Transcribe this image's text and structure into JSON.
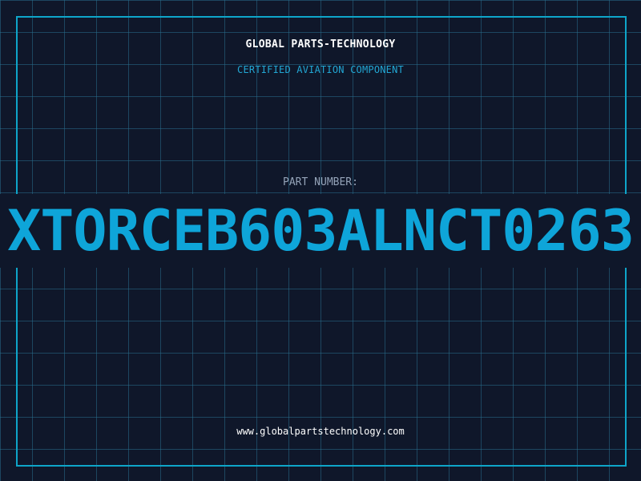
{
  "header": {
    "company": "GLOBAL PARTS-TECHNOLOGY",
    "subtitle": "CERTIFIED AVIATION COMPONENT"
  },
  "part": {
    "label": "PART NUMBER:",
    "value": "XTORCEB603ALNCT0263"
  },
  "footer": {
    "url": "www.globalpartstechnology.com"
  },
  "colors": {
    "background": "#0f172a",
    "grid": "#286e8c",
    "frame": "#0ea5c9",
    "accent": "#0ea5d9"
  }
}
